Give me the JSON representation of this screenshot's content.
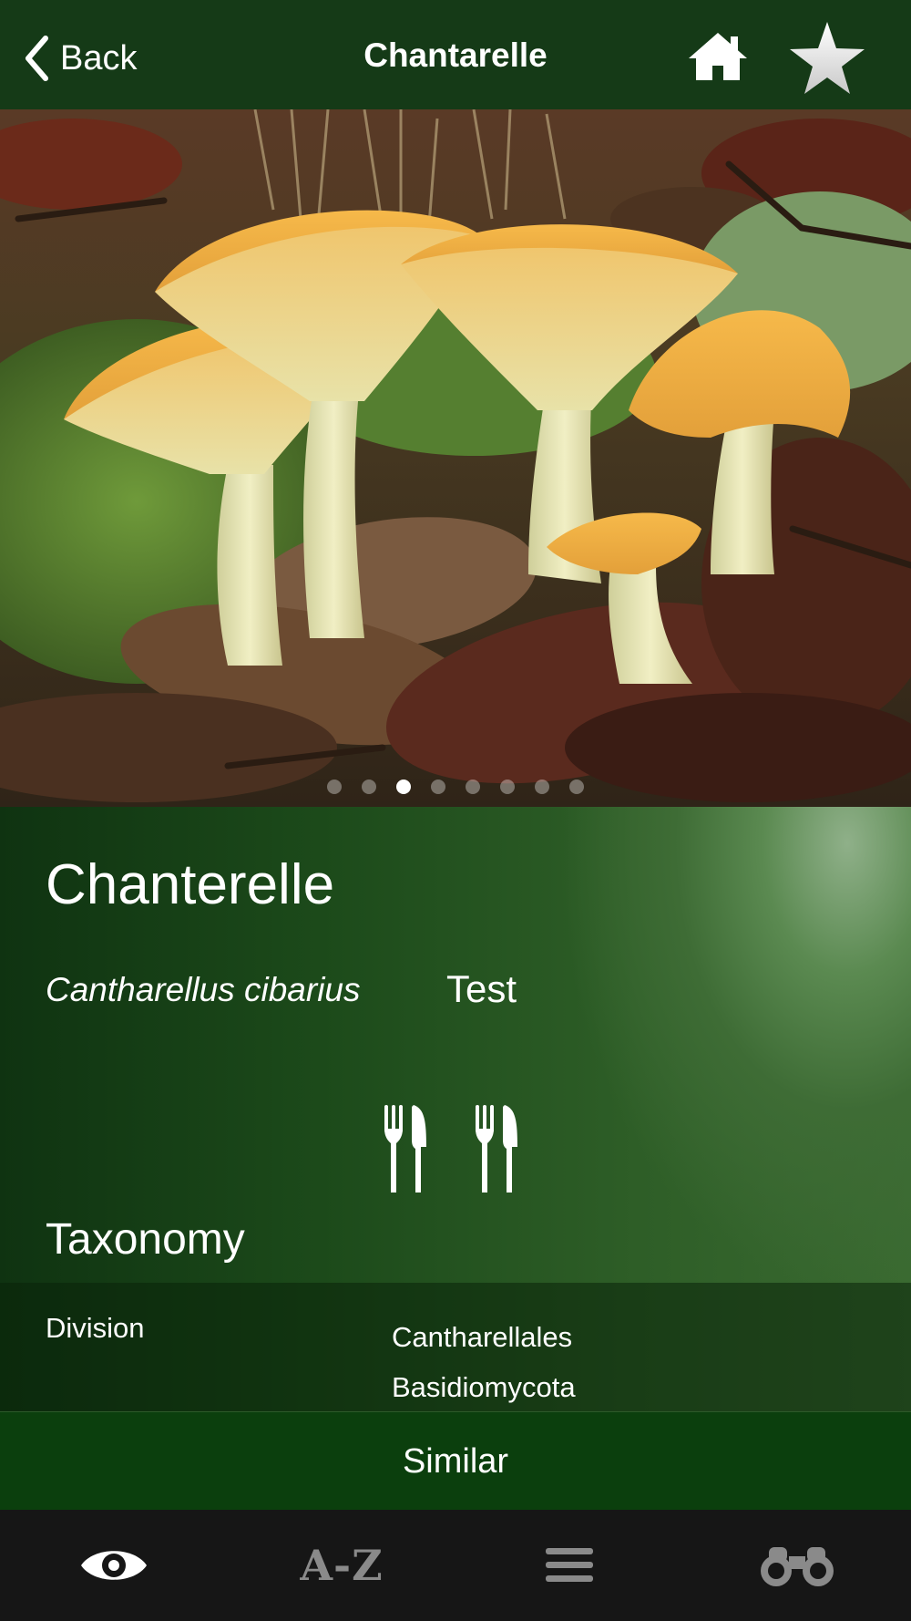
{
  "nav": {
    "back_label": "Back",
    "title": "Chantarelle",
    "home_icon": "home-icon",
    "favorite_icon": "star-icon"
  },
  "photo": {
    "pages": 8,
    "current_page": 3
  },
  "species": {
    "common_name": "Chanterelle",
    "latin_name": "Cantharellus cibarius",
    "note": "Test",
    "edibility_icons": [
      "cutlery-icon",
      "cutlery-icon"
    ]
  },
  "taxonomy": {
    "title": "Taxonomy",
    "label": "Division",
    "values": [
      "Cantharellales",
      "Basidiomycota"
    ]
  },
  "similar_button": "Similar",
  "tabs": {
    "identify_icon": "eye-icon",
    "az_label": "A-Z",
    "list_icon": "menu-icon",
    "explore_icon": "binoculars-icon"
  },
  "colors": {
    "nav_bar": "#153a17",
    "similar_bar": "#0b3f0d",
    "tab_bar": "#161616",
    "active_tab": "#ffffff",
    "inactive_tab": "#8a8a8a"
  }
}
